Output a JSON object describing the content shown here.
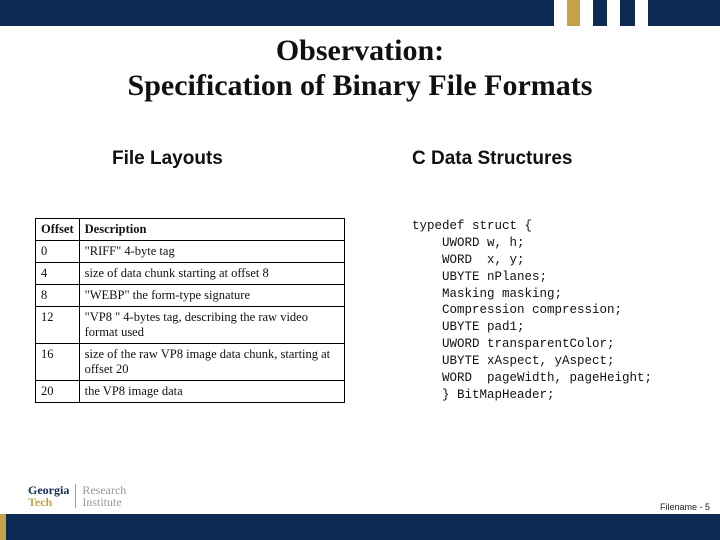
{
  "title_line1": "Observation:",
  "title_line2": "Specification of Binary File Formats",
  "left_heading": "File Layouts",
  "right_heading": "C Data Structures",
  "table": {
    "headers": [
      "Offset",
      "Description"
    ],
    "rows": [
      [
        "0",
        "\"RIFF\" 4-byte tag"
      ],
      [
        "4",
        "size of data chunk starting at offset 8"
      ],
      [
        "8",
        "\"WEBP\" the form-type signature"
      ],
      [
        "12",
        "\"VP8 \" 4-bytes tag, describing the raw video format used"
      ],
      [
        "16",
        "size of the raw VP8 image data chunk, starting at offset 20"
      ],
      [
        "20",
        "the VP8 image data"
      ]
    ]
  },
  "code_lines": [
    "typedef struct {",
    "    UWORD w, h;",
    "    WORD  x, y;",
    "    UBYTE nPlanes;",
    "    Masking masking;",
    "    Compression compression;",
    "    UBYTE pad1;",
    "    UWORD transparentColor;",
    "    UBYTE xAspect, yAspect;",
    "    WORD  pageWidth, pageHeight;",
    "    } BitMapHeader;"
  ],
  "logo": {
    "line1": "Georgia",
    "line2": "Tech",
    "ri1": "Research",
    "ri2": "Institute"
  },
  "footer": {
    "label": "Filename",
    "page": "- 5"
  }
}
